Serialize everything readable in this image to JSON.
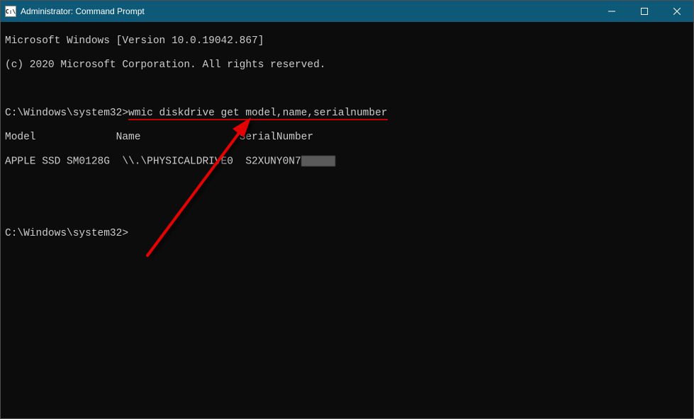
{
  "titlebar": {
    "title": "Administrator: Command Prompt",
    "icon_label": "C:\\"
  },
  "content": {
    "line1": "Microsoft Windows [Version 10.0.19042.867]",
    "line2": "(c) 2020 Microsoft Corporation. All rights reserved.",
    "prompt1_path": "C:\\Windows\\system32>",
    "prompt1_cmd": "wmic diskdrive get model,name,serialnumber",
    "headers": "Model             Name                SerialNumber",
    "row1_visible": "APPLE SSD SM0128G  \\\\.\\PHYSICALDRIVE0  S2XUNY0N7",
    "prompt2_path": "C:\\Windows\\system32>"
  },
  "table": {
    "columns": [
      "Model",
      "Name",
      "SerialNumber"
    ],
    "rows": [
      {
        "Model": "APPLE SSD SM0128G",
        "Name": "\\\\.\\PHYSICALDRIVE0",
        "SerialNumber": "S2XUNY0N7[redacted]"
      }
    ]
  }
}
